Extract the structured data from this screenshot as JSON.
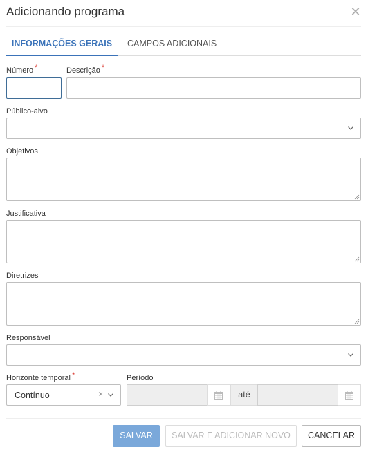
{
  "dialog": {
    "title": "Adicionando programa",
    "close_icon": "close-icon"
  },
  "tabs": [
    {
      "label": "INFORMAÇÕES GERAIS",
      "active": true
    },
    {
      "label": "CAMPOS ADICIONAIS",
      "active": false
    }
  ],
  "form": {
    "numero": {
      "label": "Número",
      "required_mark": "*",
      "value": ""
    },
    "descricao": {
      "label": "Descrição",
      "required_mark": "*",
      "value": ""
    },
    "publico_alvo": {
      "label": "Público-alvo",
      "value": ""
    },
    "objetivos": {
      "label": "Objetivos",
      "value": ""
    },
    "justificativa": {
      "label": "Justificativa",
      "value": ""
    },
    "diretrizes": {
      "label": "Diretrizes",
      "value": ""
    },
    "responsavel": {
      "label": "Responsável",
      "value": ""
    },
    "horizonte_temporal": {
      "label": "Horizonte temporal",
      "required_mark": "*",
      "value": "Contínuo",
      "clear_glyph": "×"
    },
    "periodo": {
      "label": "Período",
      "start": "",
      "separator": "até",
      "end": ""
    }
  },
  "footer": {
    "save_label": "SALVAR",
    "save_new_label": "SALVAR E ADICIONAR NOVO",
    "cancel_label": "CANCELAR"
  },
  "colors": {
    "accent": "#3b73b9",
    "required": "#d9342b",
    "save_button": "#7aa8da"
  }
}
